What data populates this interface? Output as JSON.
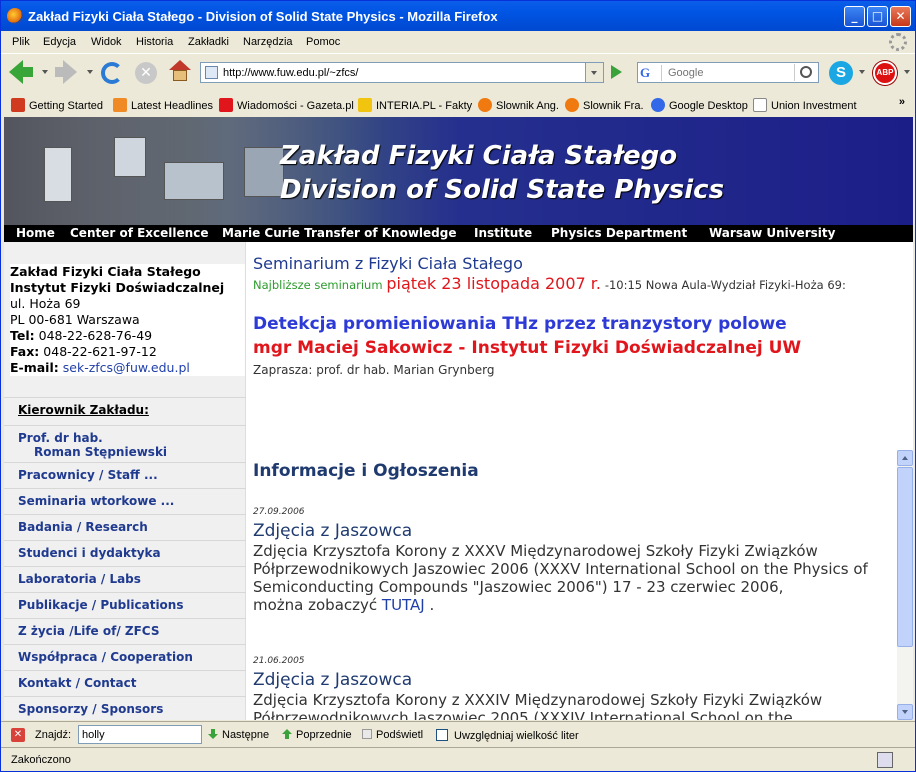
{
  "window": {
    "title": "Zakład Fizyki Ciała Stałego - Division of Solid State Physics - Mozilla Firefox",
    "min": "_",
    "max": "□",
    "close": "✕"
  },
  "menu": [
    "Plik",
    "Edycja",
    "Widok",
    "Historia",
    "Zakładki",
    "Narzędzia",
    "Pomoc"
  ],
  "url": "http://www.fuw.edu.pl/~zfcs/",
  "search": {
    "engine": "G",
    "placeholder": "Google"
  },
  "addons": {
    "skype": "S",
    "abp": "ABP"
  },
  "bookmarks": [
    {
      "label": "Getting Started",
      "color": "#d03a1e"
    },
    {
      "label": "Latest Headlines",
      "color": "#f08a24"
    },
    {
      "label": "Wiadomości - Gazeta.pl",
      "color": "#e0161c"
    },
    {
      "label": "INTERIA.PL - Fakty",
      "color": "#f1c40f"
    },
    {
      "label": "Slownik Ang.",
      "color": "#f07a10"
    },
    {
      "label": "Slownik Fra.",
      "color": "#f07a10"
    },
    {
      "label": "Google Desktop",
      "color": "#3369e8"
    },
    {
      "label": "Union Investment",
      "color": "#ffffff"
    }
  ],
  "bookmarks_more": "»",
  "banner": {
    "line1": "Zakład Fizyki Ciała Stałego",
    "line2": "Division of Solid State Physics"
  },
  "topnav": [
    "Home",
    "Center of Excellence",
    "Marie Curie Transfer of Knowledge",
    "Institute",
    "Physics Department",
    "Warsaw University"
  ],
  "address": {
    "name1": "Zakład Fizyki Ciała Stałego",
    "name2": "Instytut Fizyki Doświadczalnej",
    "street": "ul. Hoża 69",
    "city": "PL 00-681 Warszawa",
    "tel_label": "Tel:",
    "tel": "048-22-628-76-49",
    "fax_label": "Fax:",
    "fax": "048-22-621-97-12",
    "email_label": "E-mail:",
    "email": "sek-zfcs@fuw.edu.pl"
  },
  "leftmenu": {
    "head": "Kierownik Zakładu:",
    "prof1": "Prof. dr hab.",
    "prof2": "Roman Stępniewski",
    "items": [
      "Pracownicy / Staff ...",
      "Seminaria wtorkowe ...",
      "Badania / Research",
      "Studenci i dydaktyka",
      "Laboratoria / Labs",
      "Publikacje / Publications",
      "Z życia /Life of/ ZFCS",
      "Współpraca / Cooperation",
      "Kontakt / Contact",
      "Sponsorzy / Sponsors"
    ]
  },
  "seminar": {
    "title": "Seminarium z Fizyki Ciała Stałego",
    "next_label": "Najbliższe seminarium",
    "date": "piątek 23 listopada 2007 r.",
    "place": "-10:15 Nowa Aula-Wydział Fizyki-Hoża 69:",
    "talk": "Detekcja promieniowania THz przez tranzystory polowe",
    "speaker": "mgr Maciej Sakowicz - Instytut Fizyki Doświadczalnej UW",
    "invites": "Zaprasza: prof. dr hab. Marian Grynberg"
  },
  "news_heading": "Informacje i Ogłoszenia",
  "news": [
    {
      "date": "27.09.2006",
      "title": "Zdjęcia z Jaszowca",
      "text": "Zdjęcia Krzysztofa Korony z XXXV Międzynarodowej Szkoły Fizyki Związków Półprzewodnikowych Jaszowiec 2006 (XXXV International School on the Physics of Semiconducting Compounds \"Jaszowiec 2006\") 17 - 23 czerwiec 2006,",
      "more": " można zobaczyć ",
      "link": "TUTAJ",
      "tail": " ."
    },
    {
      "date": "21.06.2005",
      "title": "Zdjęcia z Jaszowca",
      "text": "Zdjęcia Krzysztofa Korony z XXXIV Międzynarodowej Szkoły Fizyki Związków Półprzewodnikowych Jaszowiec 2005 (XXXIV International School on the"
    }
  ],
  "findbar": {
    "close": "✕",
    "label": "Znajdź:",
    "value": "holly",
    "next": "Następne",
    "prev": "Poprzednie",
    "highlight": "Podświetl",
    "matchcase": "Uwzględniaj wielkość liter"
  },
  "status": "Zakończono"
}
